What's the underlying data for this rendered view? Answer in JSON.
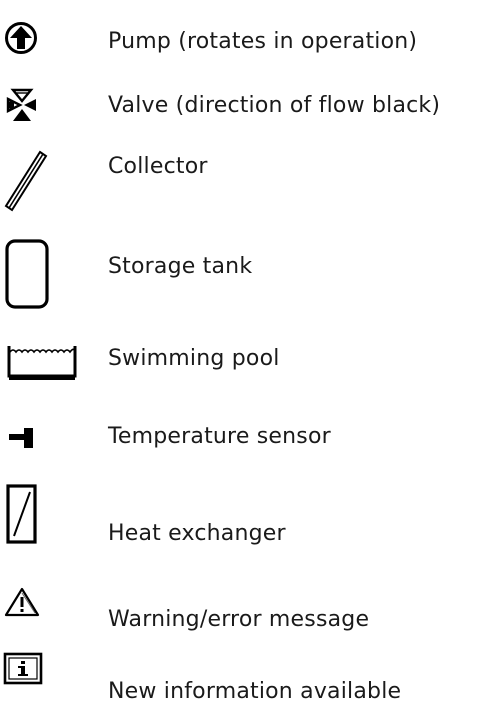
{
  "legend": {
    "items": [
      {
        "icon": "pump-icon",
        "label": "Pump (rotates in operation)"
      },
      {
        "icon": "valve-icon",
        "label": "Valve (direction of flow black)"
      },
      {
        "icon": "collector-icon",
        "label": "Collector"
      },
      {
        "icon": "storage-tank-icon",
        "label": "Storage tank"
      },
      {
        "icon": "swimming-pool-icon",
        "label": "Swimming pool"
      },
      {
        "icon": "temperature-sensor-icon",
        "label": "Temperature sensor"
      },
      {
        "icon": "heat-exchanger-icon",
        "label": "Heat exchanger"
      },
      {
        "icon": "warning-icon",
        "label": "Warning/error message"
      },
      {
        "icon": "info-icon",
        "label": "New information available"
      }
    ]
  }
}
